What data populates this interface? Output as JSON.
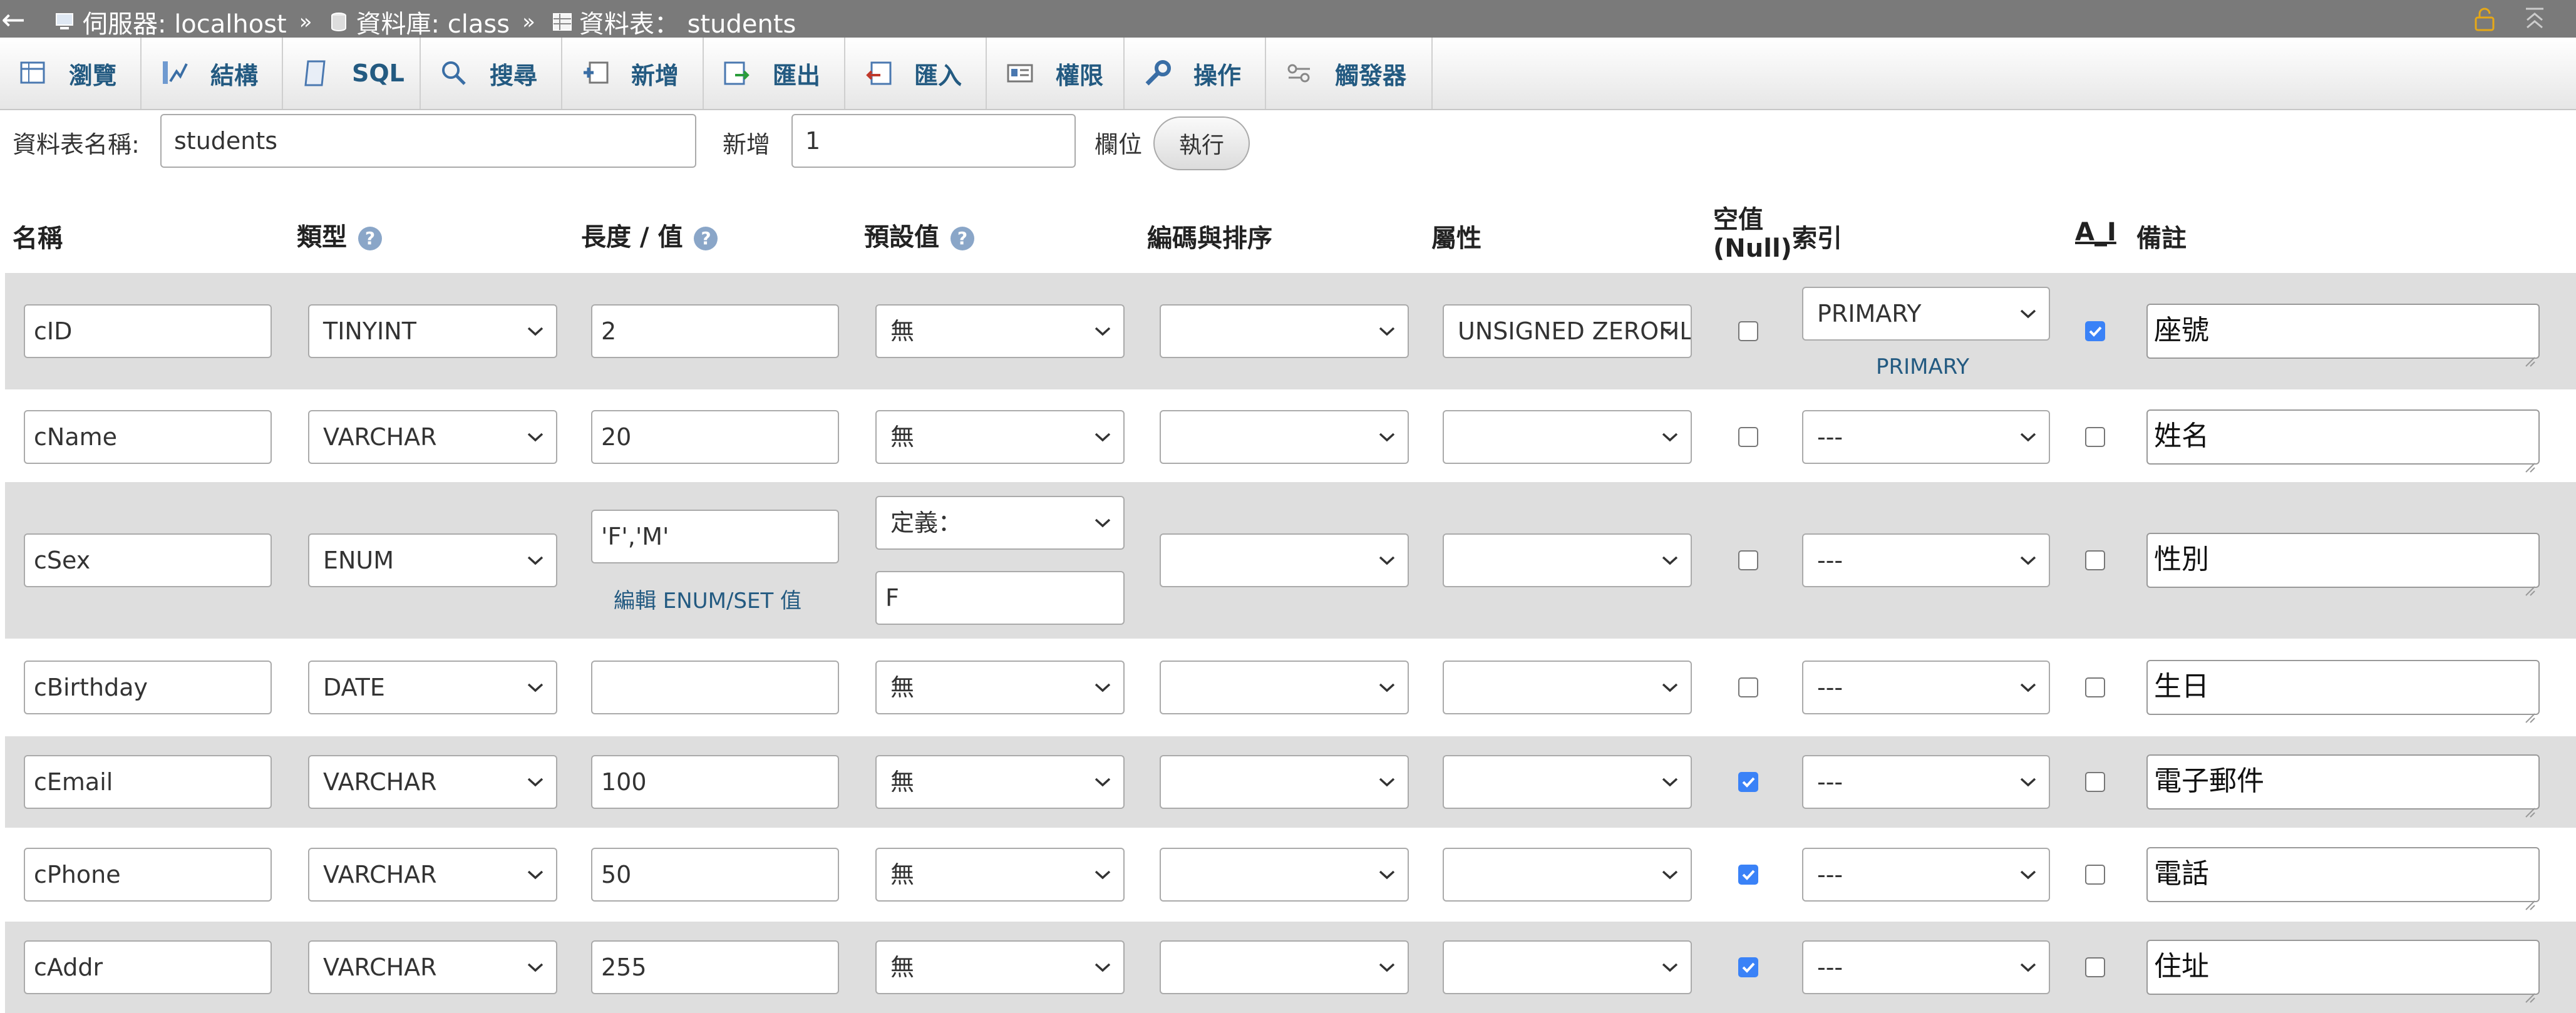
{
  "breadcrumb": {
    "back": "←",
    "server": "伺服器: localhost",
    "sep": "»",
    "database": "資料庫: class",
    "table": "資料表： students",
    "lock_icon": "lock-icon",
    "collapse_icon": "collapse-icon"
  },
  "tabs": [
    {
      "label": "瀏覽",
      "icon": "browse-icon"
    },
    {
      "label": "結構",
      "icon": "structure-icon"
    },
    {
      "label": "SQL",
      "icon": "sql-icon"
    },
    {
      "label": "搜尋",
      "icon": "search-icon"
    },
    {
      "label": "新增",
      "icon": "insert-icon"
    },
    {
      "label": "匯出",
      "icon": "export-icon"
    },
    {
      "label": "匯入",
      "icon": "import-icon"
    },
    {
      "label": "權限",
      "icon": "privileges-icon"
    },
    {
      "label": "操作",
      "icon": "operations-icon"
    },
    {
      "label": "觸發器",
      "icon": "triggers-icon"
    }
  ],
  "table_form": {
    "name_label": "資料表名稱:",
    "name_value": "students",
    "add_label": "新增",
    "add_value": "1",
    "columns_label": "欄位",
    "go_label": "執行"
  },
  "headers": {
    "name": "名稱",
    "type": "類型",
    "length": "長度 / 值",
    "default": "預設值",
    "collation": "編碼與排序",
    "attributes": "屬性",
    "null_line1": "空值",
    "null_line2": "(Null)",
    "index": "索引",
    "ai": "A_I",
    "comment": "備註"
  },
  "enum_edit_link": "編輯 ENUM/SET 值",
  "primary_note": "PRIMARY",
  "columns": [
    {
      "name": "cID",
      "type": "TINYINT",
      "length": "2",
      "default": "無",
      "collation": "",
      "attribute": "UNSIGNED ZEROFILL",
      "null": false,
      "index": "PRIMARY",
      "ai": true,
      "comment": "座號"
    },
    {
      "name": "cName",
      "type": "VARCHAR",
      "length": "20",
      "default": "無",
      "collation": "",
      "attribute": "",
      "null": false,
      "index": "---",
      "ai": false,
      "comment": "姓名"
    },
    {
      "name": "cSex",
      "type": "ENUM",
      "length": "'F','M'",
      "default": "定義：",
      "default_value": "F",
      "collation": "",
      "attribute": "",
      "null": false,
      "index": "---",
      "ai": false,
      "comment": "性別"
    },
    {
      "name": "cBirthday",
      "type": "DATE",
      "length": "",
      "default": "無",
      "collation": "",
      "attribute": "",
      "null": false,
      "index": "---",
      "ai": false,
      "comment": "生日"
    },
    {
      "name": "cEmail",
      "type": "VARCHAR",
      "length": "100",
      "default": "無",
      "collation": "",
      "attribute": "",
      "null": true,
      "index": "---",
      "ai": false,
      "comment": "電子郵件"
    },
    {
      "name": "cPhone",
      "type": "VARCHAR",
      "length": "50",
      "default": "無",
      "collation": "",
      "attribute": "",
      "null": true,
      "index": "---",
      "ai": false,
      "comment": "電話"
    },
    {
      "name": "cAddr",
      "type": "VARCHAR",
      "length": "255",
      "default": "無",
      "collation": "",
      "attribute": "",
      "null": true,
      "index": "---",
      "ai": false,
      "comment": "住址"
    }
  ],
  "colors": {
    "breadcrumb_bg": "#7a7a7a",
    "link": "#235a81",
    "row_alt": "#dedede",
    "checkbox_on": "#3a82f7"
  }
}
